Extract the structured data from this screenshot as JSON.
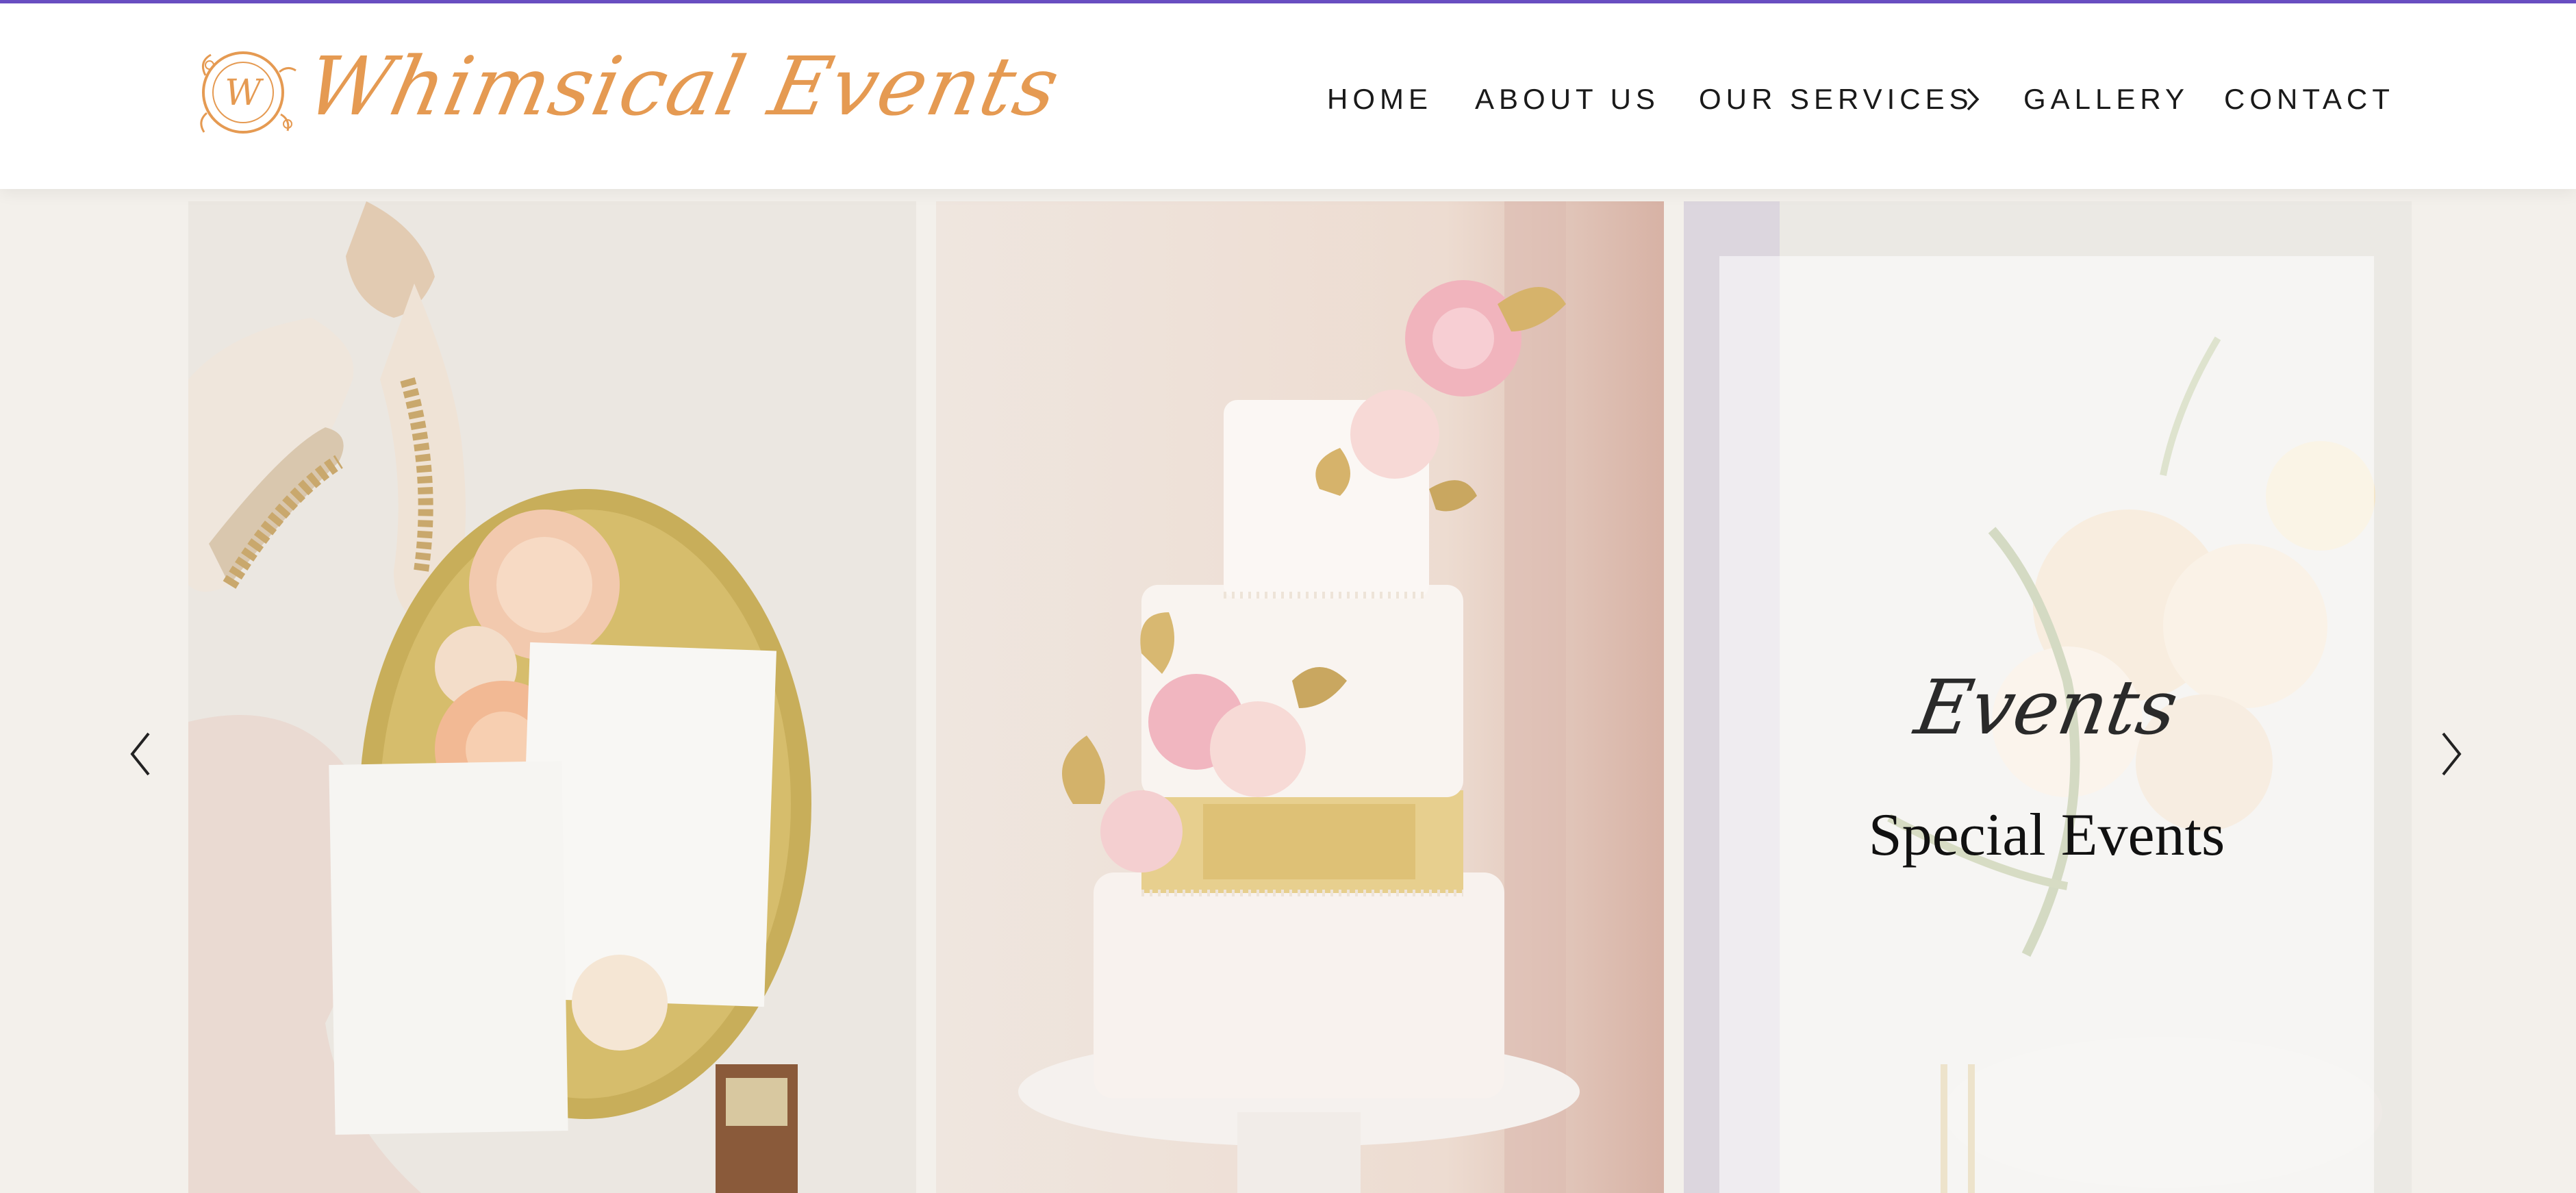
{
  "brand": {
    "logo_text": "Whimsical Events",
    "monogram": "W",
    "color": "#e59a52"
  },
  "nav": {
    "items": [
      {
        "label": "HOME"
      },
      {
        "label": "ABOUT US"
      },
      {
        "label": "OUR SERVICES"
      },
      {
        "label": "GALLERY"
      },
      {
        "label": "CONTACT"
      }
    ]
  },
  "gallery": {
    "slides": [
      {
        "name": "invitation-flatlay"
      },
      {
        "name": "wedding-cake"
      },
      {
        "name": "special-events",
        "script_text": "Events",
        "title": "Special Events"
      }
    ],
    "prev_icon": "chevron-left-icon",
    "next_icon": "chevron-right-icon"
  },
  "colors": {
    "accent_bar": "#6a4fc4",
    "background": "#f3f0eb"
  }
}
